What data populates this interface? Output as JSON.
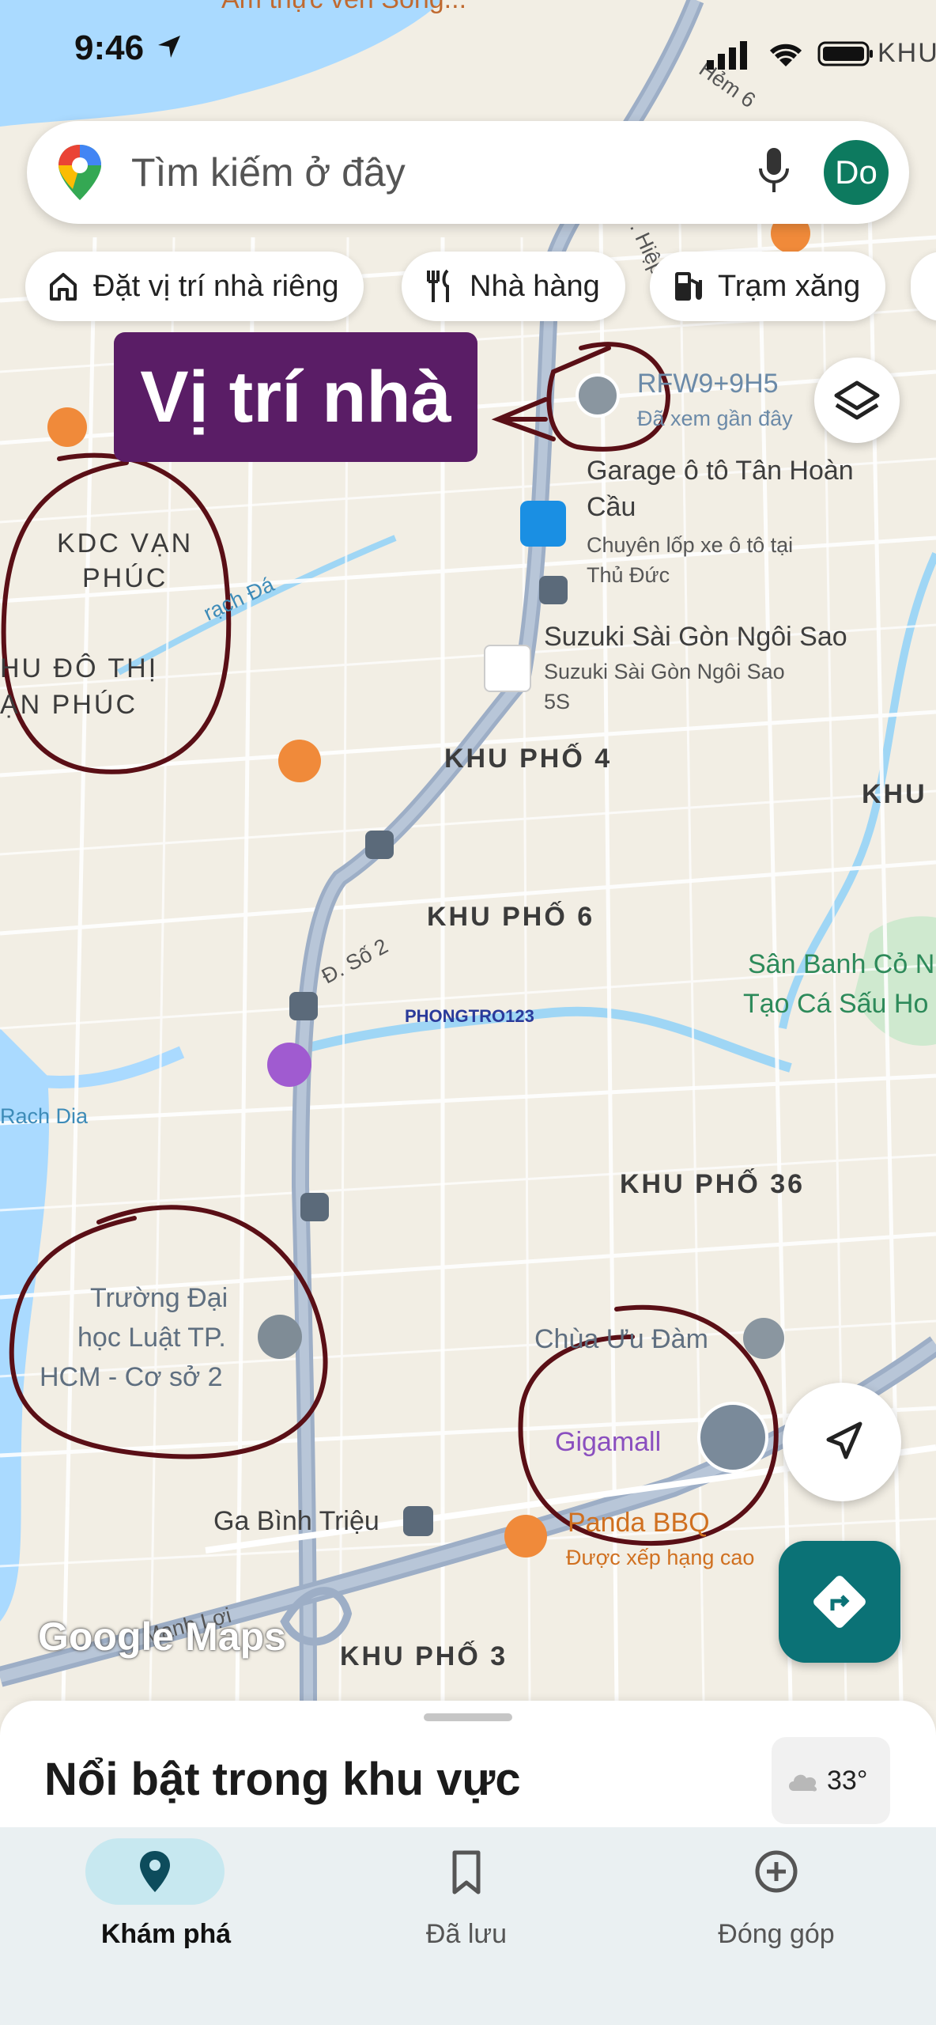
{
  "status_bar": {
    "time": "9:46",
    "carrier_edge": "KHU"
  },
  "search": {
    "placeholder": "Tìm kiếm ở đây",
    "avatar": "Do"
  },
  "chips": [
    {
      "label": "Đặt vị trí nhà riêng",
      "icon": "home-icon"
    },
    {
      "label": "Nhà hàng",
      "icon": "restaurant-icon"
    },
    {
      "label": "Trạm xăng",
      "icon": "gas-station-icon"
    }
  ],
  "annotation": {
    "banner": "Vị trí nhà"
  },
  "map_labels": {
    "top_fragment": "Ẩm thực ven Sông...",
    "hem": "Hẻm 6",
    "pin_code": "RFW9+9H5",
    "pin_sub": "Đã xem gần đây",
    "garage_1": "Garage ô tô Tân Hoàn",
    "garage_2": "Cầu",
    "garage_sub_1": "Chuyên lốp xe ô tô tại",
    "garage_sub_2": "Thủ Đức",
    "kdc_1": "KDC VẠN",
    "kdc_2": "PHÚC",
    "urban_1": "HU ĐÔ THỊ",
    "urban_2": "ẠN PHÚC",
    "rach": "rạch Đá",
    "suzuki_1": "Suzuki Sài Gòn Ngôi Sao",
    "suzuki_2": "Suzuki Sài Gòn Ngôi Sao",
    "suzuki_3": "5S",
    "kp4": "KHU PHỐ 4",
    "khu_edge": "KHU",
    "kp6": "KHU PHỐ 6",
    "road_so2": "Đ. Số 2",
    "park_1": "Sân Banh Cỏ N",
    "park_2": "Tạo Cá Sấu Ho",
    "rach_dia": "Rach Dia",
    "kp36": "KHU PHỐ 36",
    "univ_1": "Trường Đại",
    "univ_2": "học Luật TP.",
    "univ_3": "HCM - Cơ sở 2",
    "temple": "Chùa Ưu Đàm",
    "gigamall": "Gigamall",
    "station": "Ga Bình Triệu",
    "panda": "Panda BBQ",
    "panda_sub": "Được xếp hạng cao",
    "road_hl": "Đ. Hiệp",
    "road_ml": "Mạnh Lợi",
    "kp3": "KHU PHỐ 3",
    "watermark": "PHONGTRO123"
  },
  "map_logo": "Google Maps",
  "sheet": {
    "title": "Nổi bật trong khu vực",
    "weather": "33°"
  },
  "nav": [
    {
      "label": "Khám phá",
      "icon": "explore-pin-icon",
      "active": true
    },
    {
      "label": "Đã lưu",
      "icon": "bookmark-icon",
      "active": false
    },
    {
      "label": "Đóng góp",
      "icon": "add-circle-icon",
      "active": false
    }
  ],
  "colors": {
    "route_teal": "#0b7276",
    "banner_purple": "#5a1d66",
    "annotation_ink": "#5a0f16",
    "avatar_green": "#0d7a5f"
  }
}
